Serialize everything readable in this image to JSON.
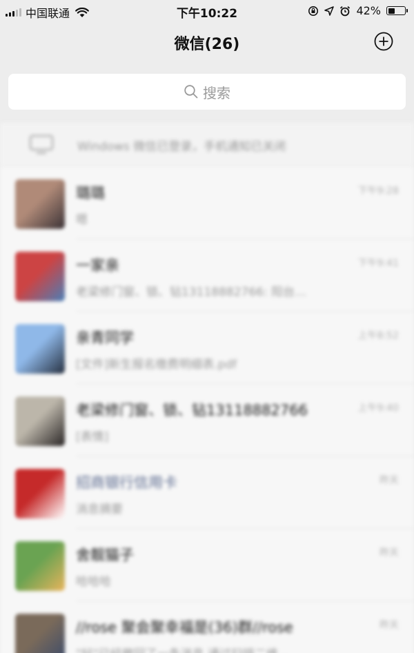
{
  "status_bar": {
    "carrier": "中国联通",
    "time": "下午10:22",
    "battery": "42%",
    "battery_level": 0.42
  },
  "nav": {
    "title": "微信(26)",
    "add_icon": "plus-circle-icon"
  },
  "search": {
    "placeholder": "搜索",
    "icon": "search-icon"
  },
  "pc_bar": {
    "icon": "monitor-icon",
    "text": "Windows 微信已登录，手机通知已关闭"
  },
  "chats": [
    {
      "name": "璐璐",
      "message": "嗯",
      "time": "下午9:28",
      "avatar_colors": [
        "#b08a78",
        "#3a3236"
      ]
    },
    {
      "name": "一家亲",
      "message": "老梁修门窗、锁、钻13118882766: 阳台…",
      "time": "下午9:41",
      "avatar_colors": [
        "#c44",
        "#4a7fb8"
      ]
    },
    {
      "name": "亲青同学",
      "message": "[文件]新生报名缴费明细表.pdf",
      "time": "上午8:52",
      "avatar_colors": [
        "#8fb8e8",
        "#263040"
      ]
    },
    {
      "name": "老梁修门窗、锁、钻13118882766",
      "message": "[表情]",
      "time": "上午9:40",
      "avatar_colors": [
        "#bcb6aa",
        "#2a2626"
      ]
    },
    {
      "name": "招商银行信用卡",
      "message": "消息摘要",
      "time": "昨天",
      "avatar_colors": [
        "#c52a2a",
        "#ffffff"
      ],
      "name_is_link": true
    },
    {
      "name": "舍靓猫子",
      "message": "哈哈哈",
      "time": "昨天",
      "avatar_colors": [
        "#6aa352",
        "#e9b45c"
      ]
    },
    {
      "name": "//rose 聚会聚幸福是(36)群//rose",
      "message": "\"好\"已经撤回了一条消息 通过扫描二维…",
      "time": "昨天",
      "avatar_colors": [
        "#7a6a5a",
        "#3a4a6a"
      ]
    }
  ]
}
